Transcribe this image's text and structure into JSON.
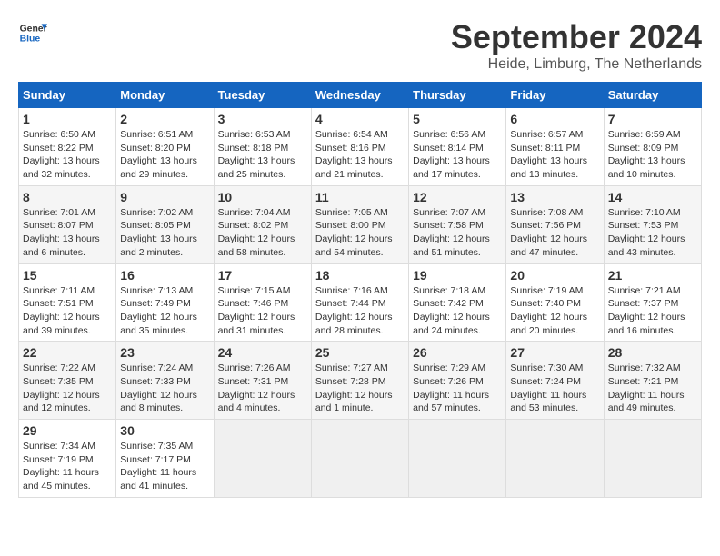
{
  "header": {
    "logo_general": "General",
    "logo_blue": "Blue",
    "month_title": "September 2024",
    "location": "Heide, Limburg, The Netherlands"
  },
  "calendar": {
    "days_of_week": [
      "Sunday",
      "Monday",
      "Tuesday",
      "Wednesday",
      "Thursday",
      "Friday",
      "Saturday"
    ],
    "weeks": [
      [
        {
          "day": "",
          "empty": true
        },
        {
          "day": "",
          "empty": true
        },
        {
          "day": "",
          "empty": true
        },
        {
          "day": "",
          "empty": true
        },
        {
          "day": "",
          "empty": true
        },
        {
          "day": "",
          "empty": true
        },
        {
          "day": "",
          "empty": true
        }
      ]
    ],
    "cells": [
      {
        "num": "1",
        "sunrise": "6:50 AM",
        "sunset": "8:22 PM",
        "daylight": "13 hours and 32 minutes."
      },
      {
        "num": "2",
        "sunrise": "6:51 AM",
        "sunset": "8:20 PM",
        "daylight": "13 hours and 29 minutes."
      },
      {
        "num": "3",
        "sunrise": "6:53 AM",
        "sunset": "8:18 PM",
        "daylight": "13 hours and 25 minutes."
      },
      {
        "num": "4",
        "sunrise": "6:54 AM",
        "sunset": "8:16 PM",
        "daylight": "13 hours and 21 minutes."
      },
      {
        "num": "5",
        "sunrise": "6:56 AM",
        "sunset": "8:14 PM",
        "daylight": "13 hours and 17 minutes."
      },
      {
        "num": "6",
        "sunrise": "6:57 AM",
        "sunset": "8:11 PM",
        "daylight": "13 hours and 13 minutes."
      },
      {
        "num": "7",
        "sunrise": "6:59 AM",
        "sunset": "8:09 PM",
        "daylight": "13 hours and 10 minutes."
      },
      {
        "num": "8",
        "sunrise": "7:01 AM",
        "sunset": "8:07 PM",
        "daylight": "13 hours and 6 minutes."
      },
      {
        "num": "9",
        "sunrise": "7:02 AM",
        "sunset": "8:05 PM",
        "daylight": "13 hours and 2 minutes."
      },
      {
        "num": "10",
        "sunrise": "7:04 AM",
        "sunset": "8:02 PM",
        "daylight": "12 hours and 58 minutes."
      },
      {
        "num": "11",
        "sunrise": "7:05 AM",
        "sunset": "8:00 PM",
        "daylight": "12 hours and 54 minutes."
      },
      {
        "num": "12",
        "sunrise": "7:07 AM",
        "sunset": "7:58 PM",
        "daylight": "12 hours and 51 minutes."
      },
      {
        "num": "13",
        "sunrise": "7:08 AM",
        "sunset": "7:56 PM",
        "daylight": "12 hours and 47 minutes."
      },
      {
        "num": "14",
        "sunrise": "7:10 AM",
        "sunset": "7:53 PM",
        "daylight": "12 hours and 43 minutes."
      },
      {
        "num": "15",
        "sunrise": "7:11 AM",
        "sunset": "7:51 PM",
        "daylight": "12 hours and 39 minutes."
      },
      {
        "num": "16",
        "sunrise": "7:13 AM",
        "sunset": "7:49 PM",
        "daylight": "12 hours and 35 minutes."
      },
      {
        "num": "17",
        "sunrise": "7:15 AM",
        "sunset": "7:46 PM",
        "daylight": "12 hours and 31 minutes."
      },
      {
        "num": "18",
        "sunrise": "7:16 AM",
        "sunset": "7:44 PM",
        "daylight": "12 hours and 28 minutes."
      },
      {
        "num": "19",
        "sunrise": "7:18 AM",
        "sunset": "7:42 PM",
        "daylight": "12 hours and 24 minutes."
      },
      {
        "num": "20",
        "sunrise": "7:19 AM",
        "sunset": "7:40 PM",
        "daylight": "12 hours and 20 minutes."
      },
      {
        "num": "21",
        "sunrise": "7:21 AM",
        "sunset": "7:37 PM",
        "daylight": "12 hours and 16 minutes."
      },
      {
        "num": "22",
        "sunrise": "7:22 AM",
        "sunset": "7:35 PM",
        "daylight": "12 hours and 12 minutes."
      },
      {
        "num": "23",
        "sunrise": "7:24 AM",
        "sunset": "7:33 PM",
        "daylight": "12 hours and 8 minutes."
      },
      {
        "num": "24",
        "sunrise": "7:26 AM",
        "sunset": "7:31 PM",
        "daylight": "12 hours and 4 minutes."
      },
      {
        "num": "25",
        "sunrise": "7:27 AM",
        "sunset": "7:28 PM",
        "daylight": "12 hours and 1 minute."
      },
      {
        "num": "26",
        "sunrise": "7:29 AM",
        "sunset": "7:26 PM",
        "daylight": "11 hours and 57 minutes."
      },
      {
        "num": "27",
        "sunrise": "7:30 AM",
        "sunset": "7:24 PM",
        "daylight": "11 hours and 53 minutes."
      },
      {
        "num": "28",
        "sunrise": "7:32 AM",
        "sunset": "7:21 PM",
        "daylight": "11 hours and 49 minutes."
      },
      {
        "num": "29",
        "sunrise": "7:34 AM",
        "sunset": "7:19 PM",
        "daylight": "11 hours and 45 minutes."
      },
      {
        "num": "30",
        "sunrise": "7:35 AM",
        "sunset": "7:17 PM",
        "daylight": "11 hours and 41 minutes."
      }
    ]
  }
}
